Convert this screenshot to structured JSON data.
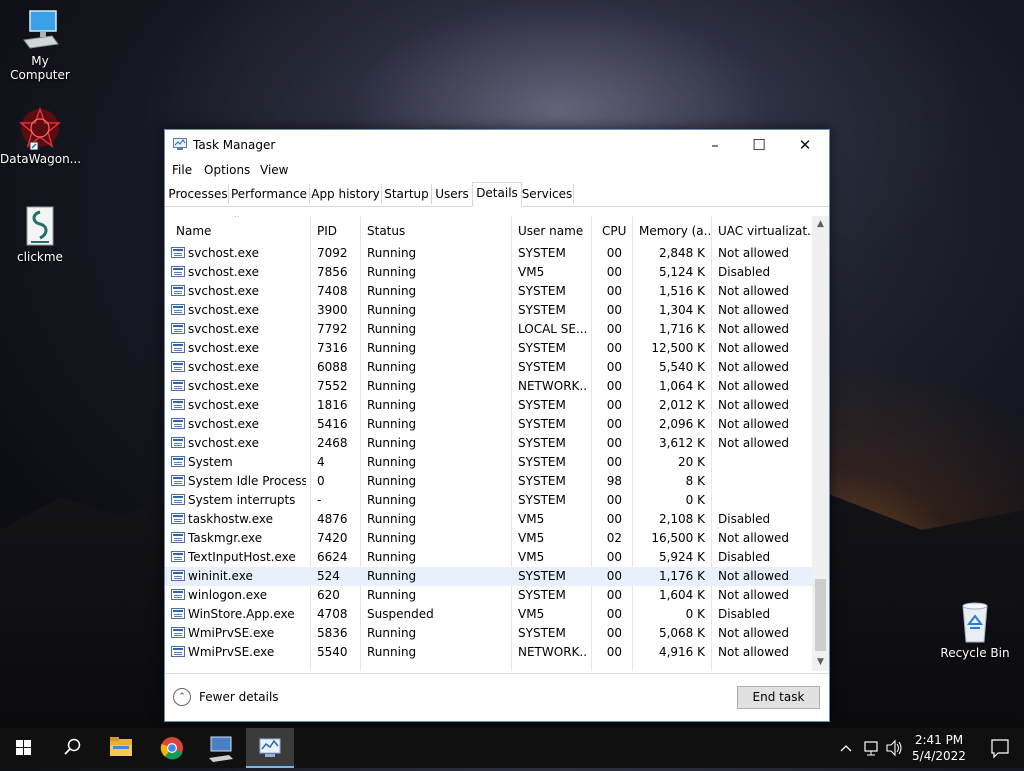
{
  "desktop": {
    "icons": [
      {
        "label": "My Computer"
      },
      {
        "label": "DataWagon..."
      },
      {
        "label": "clickme"
      },
      {
        "label": "Recycle Bin"
      }
    ]
  },
  "window": {
    "title": "Task Manager",
    "menu": [
      "File",
      "Options",
      "View"
    ],
    "tabs": [
      "Processes",
      "Performance",
      "App history",
      "Startup",
      "Users",
      "Details",
      "Services"
    ],
    "active_tab": "Details",
    "columns": [
      "Name",
      "PID",
      "Status",
      "User name",
      "CPU",
      "Memory (a...",
      "UAC virtualizat..."
    ],
    "rows": [
      {
        "name": "svchost.exe",
        "pid": "7092",
        "status": "Running",
        "user": "SYSTEM",
        "cpu": "00",
        "mem": "2,848 K",
        "uac": "Not allowed"
      },
      {
        "name": "svchost.exe",
        "pid": "7856",
        "status": "Running",
        "user": "VM5",
        "cpu": "00",
        "mem": "5,124 K",
        "uac": "Disabled"
      },
      {
        "name": "svchost.exe",
        "pid": "7408",
        "status": "Running",
        "user": "SYSTEM",
        "cpu": "00",
        "mem": "1,516 K",
        "uac": "Not allowed"
      },
      {
        "name": "svchost.exe",
        "pid": "3900",
        "status": "Running",
        "user": "SYSTEM",
        "cpu": "00",
        "mem": "1,304 K",
        "uac": "Not allowed"
      },
      {
        "name": "svchost.exe",
        "pid": "7792",
        "status": "Running",
        "user": "LOCAL SE...",
        "cpu": "00",
        "mem": "1,716 K",
        "uac": "Not allowed"
      },
      {
        "name": "svchost.exe",
        "pid": "7316",
        "status": "Running",
        "user": "SYSTEM",
        "cpu": "00",
        "mem": "12,500 K",
        "uac": "Not allowed"
      },
      {
        "name": "svchost.exe",
        "pid": "6088",
        "status": "Running",
        "user": "SYSTEM",
        "cpu": "00",
        "mem": "5,540 K",
        "uac": "Not allowed"
      },
      {
        "name": "svchost.exe",
        "pid": "7552",
        "status": "Running",
        "user": "NETWORK...",
        "cpu": "00",
        "mem": "1,064 K",
        "uac": "Not allowed"
      },
      {
        "name": "svchost.exe",
        "pid": "1816",
        "status": "Running",
        "user": "SYSTEM",
        "cpu": "00",
        "mem": "2,012 K",
        "uac": "Not allowed"
      },
      {
        "name": "svchost.exe",
        "pid": "5416",
        "status": "Running",
        "user": "SYSTEM",
        "cpu": "00",
        "mem": "2,096 K",
        "uac": "Not allowed"
      },
      {
        "name": "svchost.exe",
        "pid": "2468",
        "status": "Running",
        "user": "SYSTEM",
        "cpu": "00",
        "mem": "3,612 K",
        "uac": "Not allowed"
      },
      {
        "name": "System",
        "pid": "4",
        "status": "Running",
        "user": "SYSTEM",
        "cpu": "00",
        "mem": "20 K",
        "uac": ""
      },
      {
        "name": "System Idle Process",
        "pid": "0",
        "status": "Running",
        "user": "SYSTEM",
        "cpu": "98",
        "mem": "8 K",
        "uac": ""
      },
      {
        "name": "System interrupts",
        "pid": "-",
        "status": "Running",
        "user": "SYSTEM",
        "cpu": "00",
        "mem": "0 K",
        "uac": ""
      },
      {
        "name": "taskhostw.exe",
        "pid": "4876",
        "status": "Running",
        "user": "VM5",
        "cpu": "00",
        "mem": "2,108 K",
        "uac": "Disabled"
      },
      {
        "name": "Taskmgr.exe",
        "pid": "7420",
        "status": "Running",
        "user": "VM5",
        "cpu": "02",
        "mem": "16,500 K",
        "uac": "Not allowed"
      },
      {
        "name": "TextInputHost.exe",
        "pid": "6624",
        "status": "Running",
        "user": "VM5",
        "cpu": "00",
        "mem": "5,924 K",
        "uac": "Disabled"
      },
      {
        "name": "wininit.exe",
        "pid": "524",
        "status": "Running",
        "user": "SYSTEM",
        "cpu": "00",
        "mem": "1,176 K",
        "uac": "Not allowed"
      },
      {
        "name": "winlogon.exe",
        "pid": "620",
        "status": "Running",
        "user": "SYSTEM",
        "cpu": "00",
        "mem": "1,604 K",
        "uac": "Not allowed"
      },
      {
        "name": "WinStore.App.exe",
        "pid": "4708",
        "status": "Suspended",
        "user": "VM5",
        "cpu": "00",
        "mem": "0 K",
        "uac": "Disabled"
      },
      {
        "name": "WmiPrvSE.exe",
        "pid": "5836",
        "status": "Running",
        "user": "SYSTEM",
        "cpu": "00",
        "mem": "5,068 K",
        "uac": "Not allowed"
      },
      {
        "name": "WmiPrvSE.exe",
        "pid": "5540",
        "status": "Running",
        "user": "NETWORK...",
        "cpu": "00",
        "mem": "4,916 K",
        "uac": "Not allowed"
      }
    ],
    "selected_row": "wininit.exe",
    "footer": {
      "fewer_details": "Fewer details",
      "end_task": "End task"
    }
  },
  "taskbar": {
    "pinned_icons": [
      "windows-start-icon",
      "search-icon",
      "file-explorer-icon",
      "chrome-icon",
      "computer-icon",
      "task-manager-icon"
    ],
    "time": "2:41 PM",
    "date": "5/4/2022"
  },
  "colors": {
    "selection": "#e8f0fb",
    "taskbar": "#101010",
    "accent": "#76b9ed"
  }
}
